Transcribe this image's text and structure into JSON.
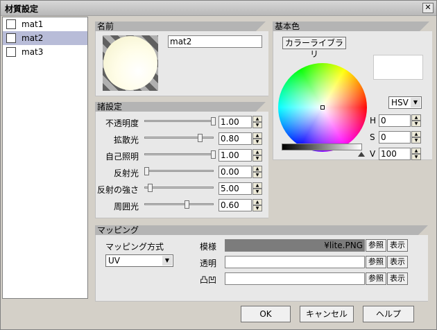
{
  "window": {
    "title": "材質設定",
    "close_glyph": "✕"
  },
  "materials": [
    {
      "label": "mat1",
      "selected": false
    },
    {
      "label": "mat2",
      "selected": true
    },
    {
      "label": "mat3",
      "selected": false
    }
  ],
  "name_section": {
    "header": "名前",
    "value": "mat2"
  },
  "settings_section": {
    "header": "諸設定",
    "rows": [
      {
        "label": "不透明度",
        "value": "1.00",
        "level": 1.0
      },
      {
        "label": "拡散光",
        "value": "0.80",
        "level": 0.8
      },
      {
        "label": "自己照明",
        "value": "1.00",
        "level": 1.0
      },
      {
        "label": "反射光",
        "value": "0.00",
        "level": 0.0
      },
      {
        "label": "反射の強さ",
        "value": "5.00",
        "level": 0.05
      },
      {
        "label": "周囲光",
        "value": "0.60",
        "level": 0.6
      }
    ]
  },
  "base_color": {
    "header": "基本色",
    "library_button": "カラーライブラリ",
    "mode": "HSV",
    "h_label": "H",
    "h_value": "0",
    "s_label": "S",
    "s_value": "0",
    "v_label": "V",
    "v_value": "100",
    "preview_color": "#ffffff"
  },
  "mapping": {
    "header": "マッピング",
    "method_label": "マッピング方式",
    "method_value": "UV",
    "rows": [
      {
        "label": "模様",
        "value": "¥lite.PNG",
        "browse": "参照",
        "show": "表示"
      },
      {
        "label": "透明",
        "value": "",
        "browse": "参照",
        "show": "表示"
      },
      {
        "label": "凸凹",
        "value": "",
        "browse": "参照",
        "show": "表示"
      }
    ]
  },
  "buttons": {
    "ok": "OK",
    "cancel": "キャンセル",
    "help": "ヘルプ"
  }
}
